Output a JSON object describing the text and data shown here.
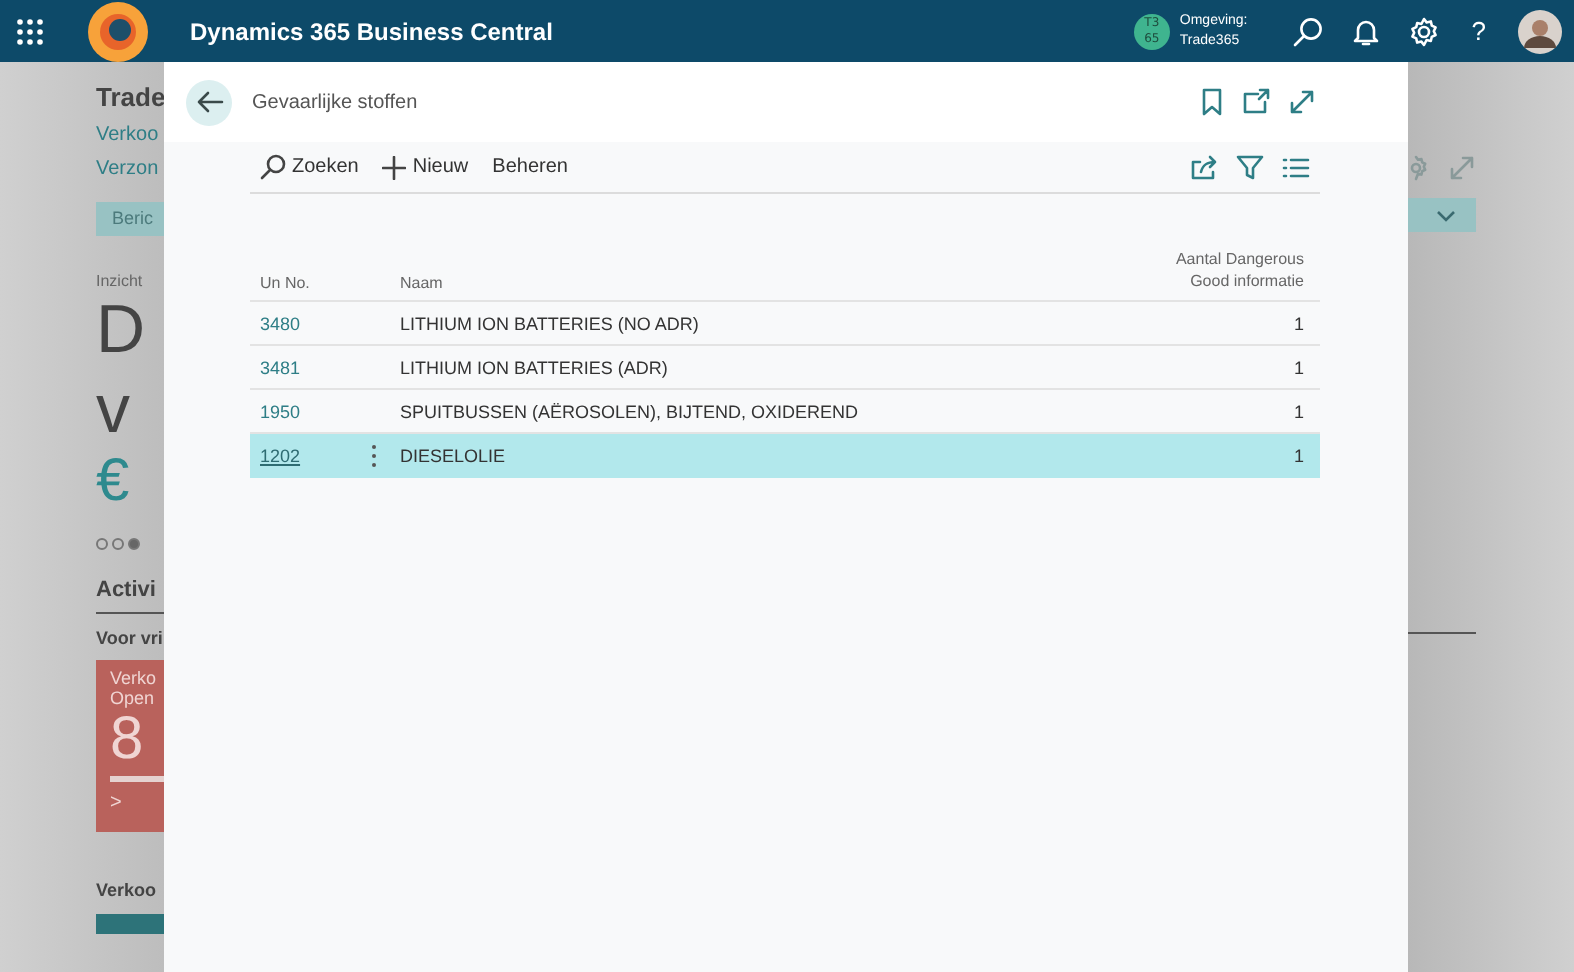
{
  "top_bar": {
    "app_title": "Dynamics 365 Business Central",
    "environment_badge": "T3 65",
    "environment_label": "Omgeving:",
    "environment_name": "Trade365",
    "help": "?"
  },
  "background_page": {
    "title": "Trade",
    "links": [
      "Verkoo",
      "Verzon"
    ],
    "action_button": "Beric",
    "insight_caption": "Inzicht",
    "headline_lines": [
      "D",
      "v"
    ],
    "amount": "€",
    "dots": [
      {
        "selected": false
      },
      {
        "selected": false
      },
      {
        "selected": true
      }
    ],
    "section_title": "Activi",
    "group_title": "Voor vri",
    "tile": {
      "lines": [
        "Verko",
        "Open"
      ],
      "count": "8",
      "level": 1,
      "arrow": ">"
    },
    "footer_group": "Verkoo"
  },
  "dialog": {
    "title": "Gevaarlijke stoffen",
    "actions": [
      {
        "kind": "search",
        "label": "Zoeken"
      },
      {
        "kind": "new",
        "label": "Nieuw"
      },
      {
        "kind": "plain",
        "label": "Beheren"
      }
    ],
    "table": {
      "columns": [
        "Un No.",
        "Naam",
        "Aantal Dangerous Good informatie"
      ],
      "rows": [
        {
          "un_no": "3480",
          "naam": "LITHIUM ION BATTERIES (NO ADR)",
          "aantal": "1",
          "selected": false
        },
        {
          "un_no": "3481",
          "naam": "LITHIUM ION BATTERIES (ADR)",
          "aantal": "1",
          "selected": false
        },
        {
          "un_no": "1950",
          "naam": "SPUITBUSSEN (AËROSOLEN), BIJTEND, OXIDEREND",
          "aantal": "1",
          "selected": false
        },
        {
          "un_no": "1202",
          "naam": "DIESELOLIE",
          "aantal": "1",
          "selected": true
        }
      ]
    }
  }
}
